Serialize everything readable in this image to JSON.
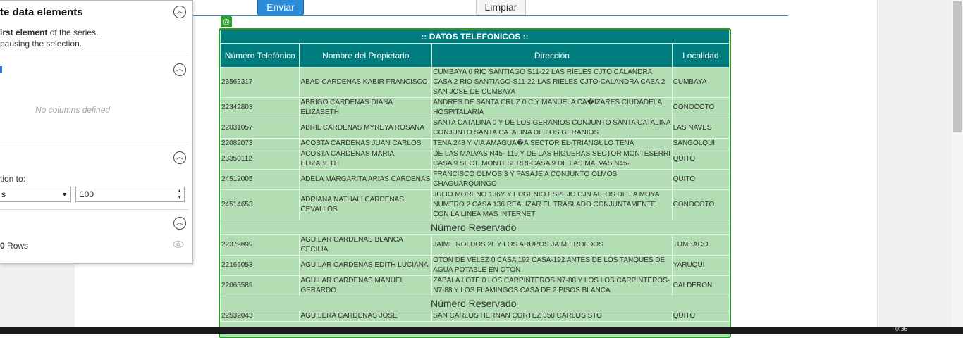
{
  "form": {
    "submit_label": "Enviar",
    "clear_label": "Limpiar"
  },
  "panel": {
    "title": "te data elements",
    "hint_bold": "irst element",
    "hint_rest": " of the series.",
    "hint_line2": "pausing the selection.",
    "section2_mark": "",
    "no_columns": "No columns defined",
    "limit_label": "tion to:",
    "select_value": "s",
    "number_value": "100",
    "rows_count": "0",
    "rows_label": "Rows"
  },
  "table": {
    "title": ":: DATOS TELEFONICOS ::",
    "headers": [
      "Número Telefónico",
      "Nombre del Propietario",
      "Dirección",
      "Localidad"
    ],
    "reserved_label": "Número Reservado",
    "rows": [
      [
        "23562317",
        "ABAD CARDENAS KABIR FRANCISCO",
        "CUMBAYA 0 RIO SANTIAGO S11-22 LAS RIELES CJTO CALANDRA CASA 2 RIO SANTIAGO-S11-22-LAS RIELES CJTO-CALANDRA CASA 2 SAN JOSE DE CUMBAYA",
        "CUMBAYA"
      ],
      [
        "22342803",
        "ABRIGO CARDENAS DIANA ELIZABETH",
        "ANDRES DE SANTA CRUZ 0 C Y MANUELA CA�IZARES CIUDADELA HOSPITALARIA",
        "CONOCOTO"
      ],
      [
        "22031057",
        "ABRIL CARDENAS MYREYA ROSANA",
        "SANTA CATALINA 0 Y DE LOS GERANIOS CONJUNTO SANTA CATALINA CONJUNTO SANTA CATALINA DE LOS GERANIOS",
        "LAS NAVES"
      ],
      [
        "22082073",
        "ACOSTA CARDENAS JUAN CARLOS",
        "TENA 248 Y VIA AMAGUA�A SECTOR EL-TRIANGULO TENA",
        "SANGOLQUI"
      ],
      [
        "23350112",
        "ACOSTA CARDENAS MARIA ELIZABETH",
        "DE LAS MALVAS N45- 119 Y DE LAS HIGUERAS SECTOR MONTESERRI CASA 9 SECT. MONTESERRI-CASA 9 DE LAS MALVAS N45-",
        "QUITO"
      ],
      [
        "24512005",
        "ADELA MARGARITA ARIAS CARDENAS",
        "FRANCISCO OLMOS 3 Y PASAJE A CONJUNTO OLMOS CHAGUARQUINGO",
        "QUITO"
      ],
      [
        "24514653",
        "ADRIANA NATHALI CARDENAS CEVALLOS",
        "JULIO MORENO 136Y Y EUGENIO ESPEJO CJN ALTOS DE LA MOYA NUMERO 2 CASA 136 REALIZAR EL TRASLADO CONJUNTAMENTE CON LA LINEA MAS INTERNET",
        "CONOCOTO"
      ],
      "reserved",
      [
        "22379899",
        "AGUILAR CARDENAS BLANCA CECILIA",
        "JAIME ROLDOS 2L Y LOS ARUPOS JAIME ROLDOS",
        "TUMBACO"
      ],
      [
        "22166053",
        "AGUILAR CARDENAS EDITH LUCIANA",
        "OTON DE VELEZ 0 CASA 192 CASA-192 ANTES DE LOS TANQUES DE AGUA POTABLE EN OTON",
        "YARUQUI"
      ],
      [
        "22065589",
        "AGUILAR CARDENAS MANUEL GERARDO",
        "ZABALA LOTE 0 LOS CARPINTEROS N7-88 Y LOS LOS CARPINTEROS-N7-88 Y LOS FLAMINGOS CASA DE 2 PISOS BLANCA",
        "CALDERON"
      ],
      "reserved",
      [
        "22532043",
        "AGUILERA CARDENAS JOSE",
        "SAN CARLOS HERNAN CORTEZ 350 CARLOS STO",
        "QUITO"
      ]
    ]
  },
  "taskbar": {
    "time": "0:36"
  }
}
